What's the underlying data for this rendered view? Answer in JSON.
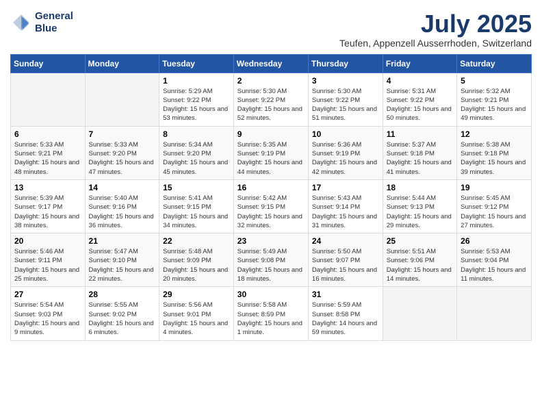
{
  "header": {
    "logo_line1": "General",
    "logo_line2": "Blue",
    "month_year": "July 2025",
    "location": "Teufen, Appenzell Ausserrhoden, Switzerland"
  },
  "days_of_week": [
    "Sunday",
    "Monday",
    "Tuesday",
    "Wednesday",
    "Thursday",
    "Friday",
    "Saturday"
  ],
  "weeks": [
    [
      {
        "day": "",
        "info": ""
      },
      {
        "day": "",
        "info": ""
      },
      {
        "day": "1",
        "info": "Sunrise: 5:29 AM\nSunset: 9:22 PM\nDaylight: 15 hours and 53 minutes."
      },
      {
        "day": "2",
        "info": "Sunrise: 5:30 AM\nSunset: 9:22 PM\nDaylight: 15 hours and 52 minutes."
      },
      {
        "day": "3",
        "info": "Sunrise: 5:30 AM\nSunset: 9:22 PM\nDaylight: 15 hours and 51 minutes."
      },
      {
        "day": "4",
        "info": "Sunrise: 5:31 AM\nSunset: 9:22 PM\nDaylight: 15 hours and 50 minutes."
      },
      {
        "day": "5",
        "info": "Sunrise: 5:32 AM\nSunset: 9:21 PM\nDaylight: 15 hours and 49 minutes."
      }
    ],
    [
      {
        "day": "6",
        "info": "Sunrise: 5:33 AM\nSunset: 9:21 PM\nDaylight: 15 hours and 48 minutes."
      },
      {
        "day": "7",
        "info": "Sunrise: 5:33 AM\nSunset: 9:20 PM\nDaylight: 15 hours and 47 minutes."
      },
      {
        "day": "8",
        "info": "Sunrise: 5:34 AM\nSunset: 9:20 PM\nDaylight: 15 hours and 45 minutes."
      },
      {
        "day": "9",
        "info": "Sunrise: 5:35 AM\nSunset: 9:19 PM\nDaylight: 15 hours and 44 minutes."
      },
      {
        "day": "10",
        "info": "Sunrise: 5:36 AM\nSunset: 9:19 PM\nDaylight: 15 hours and 42 minutes."
      },
      {
        "day": "11",
        "info": "Sunrise: 5:37 AM\nSunset: 9:18 PM\nDaylight: 15 hours and 41 minutes."
      },
      {
        "day": "12",
        "info": "Sunrise: 5:38 AM\nSunset: 9:18 PM\nDaylight: 15 hours and 39 minutes."
      }
    ],
    [
      {
        "day": "13",
        "info": "Sunrise: 5:39 AM\nSunset: 9:17 PM\nDaylight: 15 hours and 38 minutes."
      },
      {
        "day": "14",
        "info": "Sunrise: 5:40 AM\nSunset: 9:16 PM\nDaylight: 15 hours and 36 minutes."
      },
      {
        "day": "15",
        "info": "Sunrise: 5:41 AM\nSunset: 9:15 PM\nDaylight: 15 hours and 34 minutes."
      },
      {
        "day": "16",
        "info": "Sunrise: 5:42 AM\nSunset: 9:15 PM\nDaylight: 15 hours and 32 minutes."
      },
      {
        "day": "17",
        "info": "Sunrise: 5:43 AM\nSunset: 9:14 PM\nDaylight: 15 hours and 31 minutes."
      },
      {
        "day": "18",
        "info": "Sunrise: 5:44 AM\nSunset: 9:13 PM\nDaylight: 15 hours and 29 minutes."
      },
      {
        "day": "19",
        "info": "Sunrise: 5:45 AM\nSunset: 9:12 PM\nDaylight: 15 hours and 27 minutes."
      }
    ],
    [
      {
        "day": "20",
        "info": "Sunrise: 5:46 AM\nSunset: 9:11 PM\nDaylight: 15 hours and 25 minutes."
      },
      {
        "day": "21",
        "info": "Sunrise: 5:47 AM\nSunset: 9:10 PM\nDaylight: 15 hours and 22 minutes."
      },
      {
        "day": "22",
        "info": "Sunrise: 5:48 AM\nSunset: 9:09 PM\nDaylight: 15 hours and 20 minutes."
      },
      {
        "day": "23",
        "info": "Sunrise: 5:49 AM\nSunset: 9:08 PM\nDaylight: 15 hours and 18 minutes."
      },
      {
        "day": "24",
        "info": "Sunrise: 5:50 AM\nSunset: 9:07 PM\nDaylight: 15 hours and 16 minutes."
      },
      {
        "day": "25",
        "info": "Sunrise: 5:51 AM\nSunset: 9:06 PM\nDaylight: 15 hours and 14 minutes."
      },
      {
        "day": "26",
        "info": "Sunrise: 5:53 AM\nSunset: 9:04 PM\nDaylight: 15 hours and 11 minutes."
      }
    ],
    [
      {
        "day": "27",
        "info": "Sunrise: 5:54 AM\nSunset: 9:03 PM\nDaylight: 15 hours and 9 minutes."
      },
      {
        "day": "28",
        "info": "Sunrise: 5:55 AM\nSunset: 9:02 PM\nDaylight: 15 hours and 6 minutes."
      },
      {
        "day": "29",
        "info": "Sunrise: 5:56 AM\nSunset: 9:01 PM\nDaylight: 15 hours and 4 minutes."
      },
      {
        "day": "30",
        "info": "Sunrise: 5:58 AM\nSunset: 8:59 PM\nDaylight: 15 hours and 1 minute."
      },
      {
        "day": "31",
        "info": "Sunrise: 5:59 AM\nSunset: 8:58 PM\nDaylight: 14 hours and 59 minutes."
      },
      {
        "day": "",
        "info": ""
      },
      {
        "day": "",
        "info": ""
      }
    ]
  ]
}
